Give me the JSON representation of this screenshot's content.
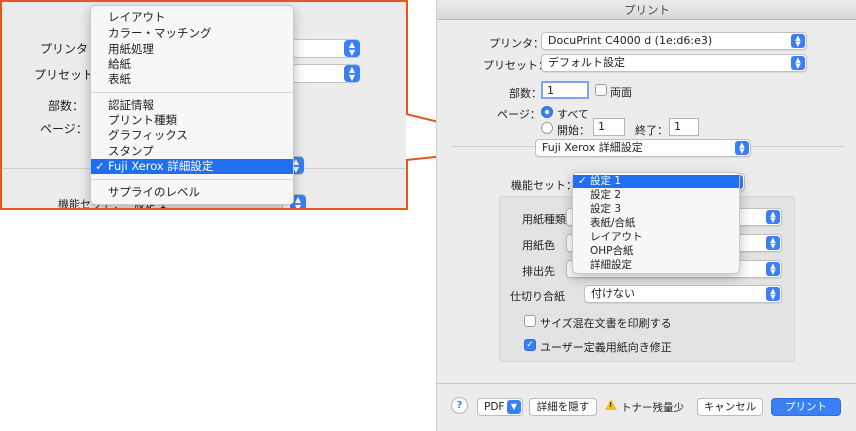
{
  "inset": {
    "labels": {
      "printer": "プリンタ：",
      "preset": "プリセット",
      "copies": "部数：",
      "pages": "ページ：",
      "feature_set": "機能セット：",
      "feature_value": "設定 1"
    },
    "menu_items": [
      "レイアウト",
      "カラー・マッチング",
      "用紙処理",
      "給紙",
      "表紙",
      "認証情報",
      "プリント種類",
      "グラフィックス",
      "スタンプ",
      "Fuji Xerox 詳細設定",
      "サプライのレベル"
    ],
    "selected_index": 9,
    "check_mark": "✓"
  },
  "dialog": {
    "title": "プリント",
    "printer_label": "プリンタ：",
    "printer_value": "DocuPrint C4000 d (1e:d6:e3)",
    "preset_label": "プリセット：",
    "preset_value": "デフォルト設定",
    "copies_label": "部数：",
    "copies_value": "1",
    "duplex_label": "両面",
    "pages_label": "ページ：",
    "all_label": "すべて",
    "from_label": "開始：",
    "from_value": "1",
    "to_label": "終了：",
    "to_value": "1",
    "section_value": "Fuji Xerox 詳細設定",
    "feature_label": "機能セット：",
    "feature_options": [
      "設定 1",
      "設定 2",
      "設定 3",
      "表紙/合紙",
      "レイアウト",
      "OHP合紙",
      "詳細設定"
    ],
    "feature_selected_index": 0,
    "check_mark": "✓",
    "paper_type_label": "用紙種類",
    "paper_color_label": "用紙色",
    "output_label": "排出先",
    "separator_label": "仕切り合紙",
    "separator_value": "付けない",
    "mixed_size_label": "サイズ混在文書を印刷する",
    "custom_paper_label": "ユーザー定義用紙向き修正",
    "help_glyph": "?",
    "pdf_label": "PDF",
    "hide_details_label": "詳細を隠す",
    "toner_low_label": "トナー残量少",
    "cancel_label": "キャンセル",
    "print_label": "プリント"
  },
  "colors": {
    "accent": "#3a7ff5",
    "highlight_border": "#e8571c",
    "menu_selection": "#1f6ff0"
  }
}
